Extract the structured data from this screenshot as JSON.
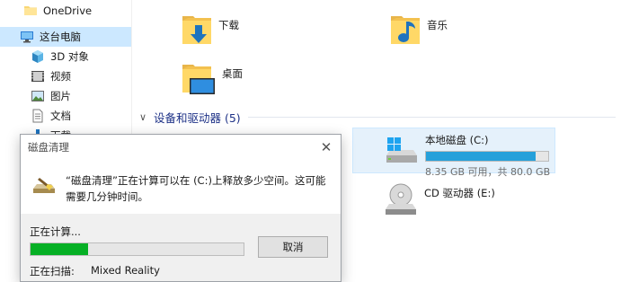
{
  "sidebar": {
    "items": [
      {
        "label": "OneDrive",
        "icon": "folder-icon"
      },
      {
        "label": "这台电脑",
        "icon": "computer-icon",
        "selected": true
      },
      {
        "label": "3D 对象",
        "icon": "3d-objects-icon"
      },
      {
        "label": "视频",
        "icon": "video-icon"
      },
      {
        "label": "图片",
        "icon": "pictures-icon"
      },
      {
        "label": "文档",
        "icon": "documents-icon"
      },
      {
        "label": "下载",
        "icon": "downloads-icon"
      }
    ]
  },
  "folders": [
    {
      "label": "下载",
      "icon": "downloads-folder-icon"
    },
    {
      "label": "音乐",
      "icon": "music-folder-icon"
    },
    {
      "label": "桌面",
      "icon": "desktop-folder-icon"
    }
  ],
  "devices_group": {
    "label": "设备和驱动器 (5)"
  },
  "drives": [
    {
      "title": "本地磁盘 (C:)",
      "free_text": "8.35 GB 可用，共 80.0 GB",
      "used_fraction": 0.896,
      "icon": "windows-drive-icon"
    },
    {
      "title": "CD 驱动器 (E:)",
      "icon": "cd-drive-icon"
    }
  ],
  "dialog": {
    "title": "磁盘清理",
    "message": "“磁盘清理”正在计算可以在 (C:)上释放多少空间。这可能需要几分钟时间。",
    "calculating_label": "正在计算...",
    "progress_fraction": 0.27,
    "cancel_label": "取消",
    "scanning_label": "正在扫描:",
    "scanning_value": "Mixed Reality"
  },
  "colors": {
    "selection": "#cce8ff",
    "accent_blue": "#26a0da",
    "progress_green": "#06b025",
    "group_header": "#1e3287"
  }
}
